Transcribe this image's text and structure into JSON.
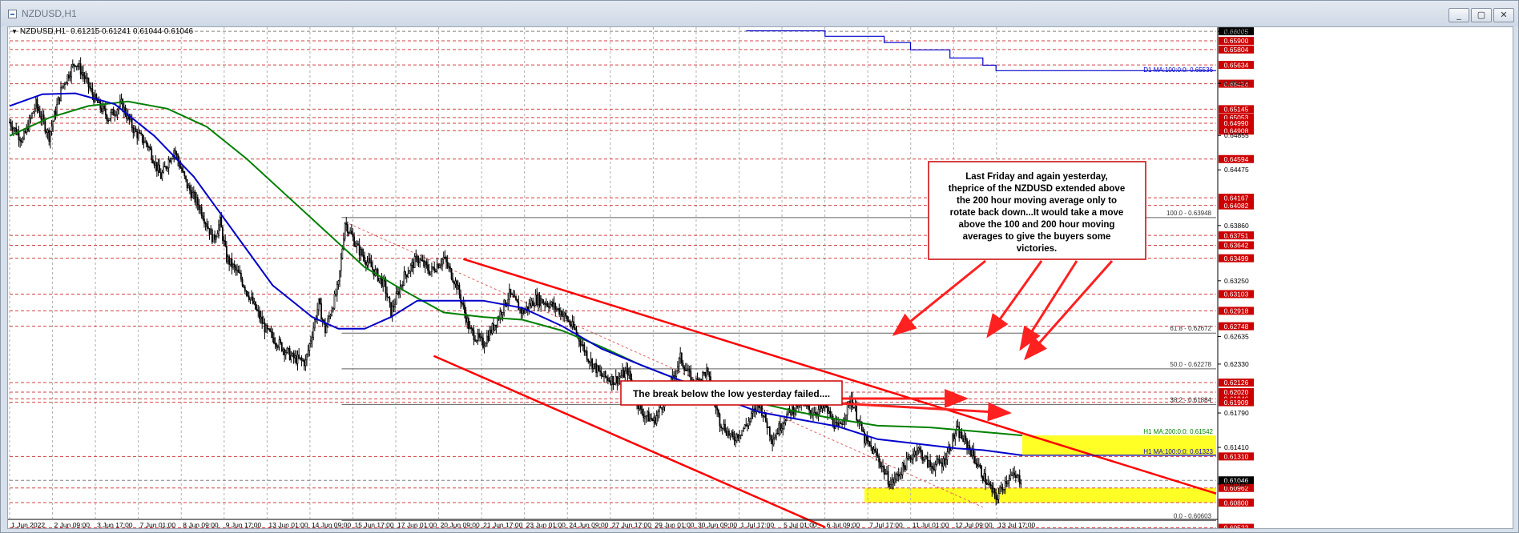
{
  "window": {
    "title": "NZDUSD,H1",
    "controls": {
      "minimize": "_",
      "restore": "▢",
      "close": "✕"
    }
  },
  "info_bar": {
    "symbol": "NZDUSD,H1",
    "ohlc": "0.61215 0.61241 0.61044 0.61046"
  },
  "chart_data": {
    "type": "candlestick",
    "symbol": "NZDUSD",
    "timeframe": "H1",
    "ylim": [
      0.605,
      0.6605
    ],
    "y_ticks": [
      0.66005,
      0.6543,
      0.64855,
      0.64475,
      0.6386,
      0.6325,
      0.62635,
      0.6233,
      0.6179,
      0.6141,
      0.61005
    ],
    "x_ticks": [
      "1 Jun 2022",
      "2 Jun 09:00",
      "3 Jun 17:00",
      "7 Jun 01:00",
      "8 Jun 09:00",
      "9 Jun 17:00",
      "13 Jun 01:00",
      "14 Jun 09:00",
      "15 Jun 17:00",
      "17 Jun 01:00",
      "20 Jun 09:00",
      "21 Jun 17:00",
      "23 Jun 01:00",
      "24 Jun 09:00",
      "27 Jun 17:00",
      "29 Jun 01:00",
      "30 Jun 09:00",
      "1 Jul 17:00",
      "5 Jul 01:00",
      "6 Jul 09:00",
      "7 Jul 17:00",
      "11 Jul 01:00",
      "12 Jul 09:00",
      "13 Jul 17:00"
    ],
    "price_path": [
      [
        0,
        0.65
      ],
      [
        2,
        0.648
      ],
      [
        4,
        0.652
      ],
      [
        6,
        0.6485
      ],
      [
        8,
        0.654
      ],
      [
        10,
        0.6567
      ],
      [
        11,
        0.6555
      ],
      [
        13,
        0.6525
      ],
      [
        15,
        0.6505
      ],
      [
        17,
        0.652
      ],
      [
        19,
        0.649
      ],
      [
        21,
        0.6475
      ],
      [
        23,
        0.644
      ],
      [
        25,
        0.647
      ],
      [
        27,
        0.643
      ],
      [
        29,
        0.6405
      ],
      [
        31,
        0.637
      ],
      [
        32,
        0.639
      ],
      [
        33,
        0.635
      ],
      [
        35,
        0.633
      ],
      [
        37,
        0.63
      ],
      [
        39,
        0.627
      ],
      [
        41,
        0.6255
      ],
      [
        43,
        0.624
      ],
      [
        45,
        0.6235
      ],
      [
        47,
        0.63
      ],
      [
        48,
        0.627
      ],
      [
        50,
        0.632
      ],
      [
        51,
        0.639
      ],
      [
        53,
        0.636
      ],
      [
        55,
        0.634
      ],
      [
        57,
        0.632
      ],
      [
        58,
        0.629
      ],
      [
        60,
        0.633
      ],
      [
        62,
        0.635
      ],
      [
        64,
        0.6335
      ],
      [
        66,
        0.635
      ],
      [
        68,
        0.632
      ],
      [
        70,
        0.627
      ],
      [
        72,
        0.6255
      ],
      [
        74,
        0.628
      ],
      [
        76,
        0.631
      ],
      [
        78,
        0.629
      ],
      [
        80,
        0.6305
      ],
      [
        82,
        0.63
      ],
      [
        84,
        0.629
      ],
      [
        86,
        0.627
      ],
      [
        88,
        0.624
      ],
      [
        90,
        0.622
      ],
      [
        92,
        0.6215
      ],
      [
        94,
        0.6225
      ],
      [
        96,
        0.618
      ],
      [
        98,
        0.617
      ],
      [
        100,
        0.62
      ],
      [
        102,
        0.624
      ],
      [
        104,
        0.621
      ],
      [
        106,
        0.6225
      ],
      [
        108,
        0.617
      ],
      [
        110,
        0.615
      ],
      [
        112,
        0.6165
      ],
      [
        114,
        0.619
      ],
      [
        116,
        0.615
      ],
      [
        118,
        0.6175
      ],
      [
        120,
        0.619
      ],
      [
        122,
        0.618
      ],
      [
        124,
        0.6185
      ],
      [
        126,
        0.616
      ],
      [
        128,
        0.6195
      ],
      [
        130,
        0.615
      ],
      [
        132,
        0.613
      ],
      [
        134,
        0.61
      ],
      [
        136,
        0.612
      ],
      [
        138,
        0.614
      ],
      [
        140,
        0.612
      ],
      [
        142,
        0.6125
      ],
      [
        144,
        0.616
      ],
      [
        146,
        0.614
      ],
      [
        148,
        0.611
      ],
      [
        150,
        0.6085
      ],
      [
        152,
        0.611
      ],
      [
        154,
        0.6105
      ]
    ],
    "moving_averages": [
      {
        "name": "H1 MA:100:0:0",
        "color": "#0000cc",
        "value": 0.61323
      },
      {
        "name": "H1 MA:200:0:0",
        "color": "#008000",
        "value": 0.61542
      },
      {
        "name": "D1 MA:100:0:0",
        "color": "#0000cc",
        "value": 0.65536
      }
    ],
    "fibonacci": [
      {
        "label": "100.0 - 0.63948",
        "value": 0.63948
      },
      {
        "label": "61.8 - 0.62672",
        "value": 0.62672
      },
      {
        "label": "50.0 - 0.62278",
        "value": 0.62278
      },
      {
        "label": "38.2 - 0.61884",
        "value": 0.61884
      },
      {
        "label": "0.0 - 0.60603",
        "value": 0.60603
      }
    ],
    "price_levels": [
      {
        "value": 0.66005,
        "color": "#000000"
      },
      {
        "value": 0.659,
        "color": "#cc0000"
      },
      {
        "value": 0.65804,
        "color": "#cc0000"
      },
      {
        "value": 0.65634,
        "color": "#cc0000"
      },
      {
        "value": 0.65426,
        "color": "#cc0000"
      },
      {
        "value": 0.65145,
        "color": "#cc0000"
      },
      {
        "value": 0.65053,
        "color": "#cc0000"
      },
      {
        "value": 0.6499,
        "color": "#cc0000"
      },
      {
        "value": 0.64908,
        "color": "#cc0000"
      },
      {
        "value": 0.64594,
        "color": "#cc0000"
      },
      {
        "value": 0.64167,
        "color": "#cc0000"
      },
      {
        "value": 0.64082,
        "color": "#cc0000"
      },
      {
        "value": 0.63751,
        "color": "#cc0000"
      },
      {
        "value": 0.63642,
        "color": "#cc0000"
      },
      {
        "value": 0.63499,
        "color": "#cc0000"
      },
      {
        "value": 0.63103,
        "color": "#cc0000"
      },
      {
        "value": 0.62918,
        "color": "#cc0000"
      },
      {
        "value": 0.62748,
        "color": "#cc0000"
      },
      {
        "value": 0.62126,
        "color": "#cc0000"
      },
      {
        "value": 0.6202,
        "color": "#cc0000"
      },
      {
        "value": 0.61946,
        "color": "#cc0000"
      },
      {
        "value": 0.61909,
        "color": "#cc0000"
      },
      {
        "value": 0.6131,
        "color": "#cc0000"
      },
      {
        "value": 0.61046,
        "color": "#000000"
      },
      {
        "value": 0.60962,
        "color": "#cc0000"
      },
      {
        "value": 0.608,
        "color": "#cc0000"
      },
      {
        "value": 0.60522,
        "color": "#cc0000"
      }
    ],
    "zones": [
      {
        "name": "ma-zone",
        "from": 0.61323,
        "to": 0.61542,
        "color": "#ffff00"
      },
      {
        "name": "low-zone",
        "from": 0.608,
        "to": 0.60962,
        "color": "#ffff00"
      }
    ],
    "annotations": {
      "callout_ma": "Last Friday and again yesterday, theprice of the NZDUSD extended above the 200 hour moving average only to rotate back down...It would take a move above the 100 and 200 hour moving averages to give the buyers some victories.",
      "callout_break": "The break below the low yesterday failed...."
    },
    "colors": {
      "price": "#000000",
      "trendline": "#ff0000",
      "highlight": "#ffff00"
    }
  }
}
